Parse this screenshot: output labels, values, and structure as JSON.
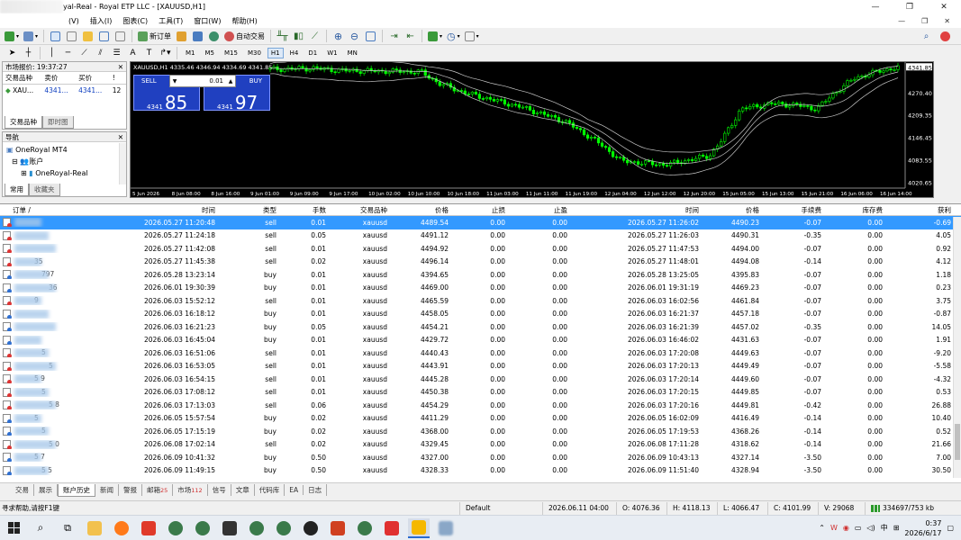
{
  "window": {
    "title": "yal-Real - Royal ETP LLC - [XAUUSD,H1]",
    "controls": [
      "—",
      "❐",
      "✕"
    ]
  },
  "menu": {
    "items": [
      "(V)",
      "插入(I)",
      "图表(C)",
      "工具(T)",
      "窗口(W)",
      "帮助(H)"
    ],
    "mdi_controls": [
      "—",
      "❐",
      "✕"
    ]
  },
  "toolbar": {
    "new_order": "新订单",
    "auto_trade": "自动交易"
  },
  "timeframes": [
    "M1",
    "M5",
    "M15",
    "M30",
    "H1",
    "H4",
    "D1",
    "W1",
    "MN"
  ],
  "timeframe_active": "H1",
  "market_watch": {
    "title": "市场报价: 19:37:27",
    "headers": [
      "交易品种",
      "卖价",
      "买价",
      "!"
    ],
    "rows": [
      {
        "symbol": "XAU...",
        "bid": "4341...",
        "ask": "4341...",
        "spread": "12"
      }
    ],
    "tabs": [
      "交易品种",
      "即时图"
    ]
  },
  "navigator": {
    "title": "导航",
    "items": [
      "OneRoyal MT4",
      "账户",
      "OneRoyal-Real"
    ],
    "tabs": [
      "常用",
      "收藏夹"
    ]
  },
  "chart": {
    "header": "XAUUSD,H1  4335.46 4346.94 4334.69 4341.85",
    "sell_label": "SELL",
    "buy_label": "BUY",
    "lot": "0.01",
    "sell_small": "4341",
    "sell_big": "85",
    "buy_small": "4341",
    "buy_big": "97",
    "current_price": "4341.85",
    "y_ticks": [
      "4341.85",
      "4270.40",
      "4209.35",
      "4146.45",
      "4083.55",
      "4020.65"
    ],
    "x_ticks": [
      "5 Jun 2026",
      "8 Jun 08:00",
      "8 Jun 16:00",
      "9 Jun 01:00",
      "9 Jun 09:00",
      "9 Jun 17:00",
      "10 Jun 02:00",
      "10 Jun 10:00",
      "10 Jun 18:00",
      "11 Jun 03:00",
      "11 Jun 11:00",
      "11 Jun 19:00",
      "12 Jun 04:00",
      "12 Jun 12:00",
      "12 Jun 20:00",
      "15 Jun 05:00",
      "15 Jun 13:00",
      "15 Jun 21:00",
      "16 Jun 06:00",
      "16 Jun 14:00"
    ],
    "colors": {
      "bull": "#00ff00",
      "bear": "#00ff00",
      "bands": "#c8c8c8",
      "background": "#000000"
    }
  },
  "terminal": {
    "headers": [
      "订单 /",
      "时间",
      "类型",
      "手数",
      "交易品种",
      "价格",
      "止损",
      "止盈",
      "时间",
      "价格",
      "手续费",
      "库存费",
      "获利"
    ],
    "rows": [
      {
        "id": "",
        "open_time": "2026.05.27 11:20:48",
        "type": "sell",
        "lots": "0.01",
        "symbol": "xauusd",
        "price": "4489.54",
        "sl": "0.00",
        "tp": "0.00",
        "close_time": "2026.05.27 11:26:02",
        "close_price": "4490.23",
        "commission": "-0.07",
        "swap": "0.00",
        "profit": "-0.69"
      },
      {
        "id": "",
        "open_time": "2026.05.27 11:24:18",
        "type": "sell",
        "lots": "0.05",
        "symbol": "xauusd",
        "price": "4491.12",
        "sl": "0.00",
        "tp": "0.00",
        "close_time": "2026.05.27 11:26:03",
        "close_price": "4490.31",
        "commission": "-0.35",
        "swap": "0.00",
        "profit": "4.05"
      },
      {
        "id": "",
        "open_time": "2026.05.27 11:42:08",
        "type": "sell",
        "lots": "0.01",
        "symbol": "xauusd",
        "price": "4494.92",
        "sl": "0.00",
        "tp": "0.00",
        "close_time": "2026.05.27 11:47:53",
        "close_price": "4494.00",
        "commission": "-0.07",
        "swap": "0.00",
        "profit": "0.92"
      },
      {
        "id": "35",
        "open_time": "2026.05.27 11:45:38",
        "type": "sell",
        "lots": "0.02",
        "symbol": "xauusd",
        "price": "4496.14",
        "sl": "0.00",
        "tp": "0.00",
        "close_time": "2026.05.27 11:48:01",
        "close_price": "4494.08",
        "commission": "-0.14",
        "swap": "0.00",
        "profit": "4.12"
      },
      {
        "id": "797",
        "open_time": "2026.05.28 13:23:14",
        "type": "buy",
        "lots": "0.01",
        "symbol": "xauusd",
        "price": "4394.65",
        "sl": "0.00",
        "tp": "0.00",
        "close_time": "2026.05.28 13:25:05",
        "close_price": "4395.83",
        "commission": "-0.07",
        "swap": "0.00",
        "profit": "1.18"
      },
      {
        "id": "36",
        "open_time": "2026.06.01 19:30:39",
        "type": "buy",
        "lots": "0.01",
        "symbol": "xauusd",
        "price": "4469.00",
        "sl": "0.00",
        "tp": "0.00",
        "close_time": "2026.06.01 19:31:19",
        "close_price": "4469.23",
        "commission": "-0.07",
        "swap": "0.00",
        "profit": "0.23"
      },
      {
        "id": "9",
        "open_time": "2026.06.03 15:52:12",
        "type": "sell",
        "lots": "0.01",
        "symbol": "xauusd",
        "price": "4465.59",
        "sl": "0.00",
        "tp": "0.00",
        "close_time": "2026.06.03 16:02:56",
        "close_price": "4461.84",
        "commission": "-0.07",
        "swap": "0.00",
        "profit": "3.75"
      },
      {
        "id": "",
        "open_time": "2026.06.03 16:18:12",
        "type": "buy",
        "lots": "0.01",
        "symbol": "xauusd",
        "price": "4458.05",
        "sl": "0.00",
        "tp": "0.00",
        "close_time": "2026.06.03 16:21:37",
        "close_price": "4457.18",
        "commission": "-0.07",
        "swap": "0.00",
        "profit": "-0.87"
      },
      {
        "id": "",
        "open_time": "2026.06.03 16:21:23",
        "type": "buy",
        "lots": "0.05",
        "symbol": "xauusd",
        "price": "4454.21",
        "sl": "0.00",
        "tp": "0.00",
        "close_time": "2026.06.03 16:21:39",
        "close_price": "4457.02",
        "commission": "-0.35",
        "swap": "0.00",
        "profit": "14.05"
      },
      {
        "id": "",
        "open_time": "2026.06.03 16:45:04",
        "type": "buy",
        "lots": "0.01",
        "symbol": "xauusd",
        "price": "4429.72",
        "sl": "0.00",
        "tp": "0.00",
        "close_time": "2026.06.03 16:46:02",
        "close_price": "4431.63",
        "commission": "-0.07",
        "swap": "0.00",
        "profit": "1.91"
      },
      {
        "id": "5",
        "open_time": "2026.06.03 16:51:06",
        "type": "sell",
        "lots": "0.01",
        "symbol": "xauusd",
        "price": "4440.43",
        "sl": "0.00",
        "tp": "0.00",
        "close_time": "2026.06.03 17:20:08",
        "close_price": "4449.63",
        "commission": "-0.07",
        "swap": "0.00",
        "profit": "-9.20"
      },
      {
        "id": "5",
        "open_time": "2026.06.03 16:53:05",
        "type": "sell",
        "lots": "0.01",
        "symbol": "xauusd",
        "price": "4443.91",
        "sl": "0.00",
        "tp": "0.00",
        "close_time": "2026.06.03 17:20:13",
        "close_price": "4449.49",
        "commission": "-0.07",
        "swap": "0.00",
        "profit": "-5.58"
      },
      {
        "id": "5 9",
        "open_time": "2026.06.03 16:54:15",
        "type": "sell",
        "lots": "0.01",
        "symbol": "xauusd",
        "price": "4445.28",
        "sl": "0.00",
        "tp": "0.00",
        "close_time": "2026.06.03 17:20:14",
        "close_price": "4449.60",
        "commission": "-0.07",
        "swap": "0.00",
        "profit": "-4.32"
      },
      {
        "id": "5",
        "open_time": "2026.06.03 17:08:12",
        "type": "sell",
        "lots": "0.01",
        "symbol": "xauusd",
        "price": "4450.38",
        "sl": "0.00",
        "tp": "0.00",
        "close_time": "2026.06.03 17:20:15",
        "close_price": "4449.85",
        "commission": "-0.07",
        "swap": "0.00",
        "profit": "0.53"
      },
      {
        "id": "5 8",
        "open_time": "2026.06.03 17:13:03",
        "type": "sell",
        "lots": "0.06",
        "symbol": "xauusd",
        "price": "4454.29",
        "sl": "0.00",
        "tp": "0.00",
        "close_time": "2026.06.03 17:20:16",
        "close_price": "4449.81",
        "commission": "-0.42",
        "swap": "0.00",
        "profit": "26.88"
      },
      {
        "id": "5",
        "open_time": "2026.06.05 15:57:54",
        "type": "buy",
        "lots": "0.02",
        "symbol": "xauusd",
        "price": "4411.29",
        "sl": "0.00",
        "tp": "0.00",
        "close_time": "2026.06.05 16:02:09",
        "close_price": "4416.49",
        "commission": "-0.14",
        "swap": "0.00",
        "profit": "10.40"
      },
      {
        "id": "5",
        "open_time": "2026.06.05 17:15:19",
        "type": "buy",
        "lots": "0.02",
        "symbol": "xauusd",
        "price": "4368.00",
        "sl": "0.00",
        "tp": "0.00",
        "close_time": "2026.06.05 17:19:53",
        "close_price": "4368.26",
        "commission": "-0.14",
        "swap": "0.00",
        "profit": "0.52"
      },
      {
        "id": "5 0",
        "open_time": "2026.06.08 17:02:14",
        "type": "sell",
        "lots": "0.02",
        "symbol": "xauusd",
        "price": "4329.45",
        "sl": "0.00",
        "tp": "0.00",
        "close_time": "2026.06.08 17:11:28",
        "close_price": "4318.62",
        "commission": "-0.14",
        "swap": "0.00",
        "profit": "21.66"
      },
      {
        "id": "5 7",
        "open_time": "2026.06.09 10:41:32",
        "type": "buy",
        "lots": "0.50",
        "symbol": "xauusd",
        "price": "4327.00",
        "sl": "0.00",
        "tp": "0.00",
        "close_time": "2026.06.09 10:43:13",
        "close_price": "4327.14",
        "commission": "-3.50",
        "swap": "0.00",
        "profit": "7.00"
      },
      {
        "id": "5 5",
        "open_time": "2026.06.09 11:49:15",
        "type": "buy",
        "lots": "0.50",
        "symbol": "xauusd",
        "price": "4328.33",
        "sl": "0.00",
        "tp": "0.00",
        "close_time": "2026.06.09 11:51:40",
        "close_price": "4328.94",
        "commission": "-3.50",
        "swap": "0.00",
        "profit": "30.50"
      }
    ],
    "tabs": [
      {
        "label": "交易",
        "count": ""
      },
      {
        "label": "展示",
        "count": ""
      },
      {
        "label": "账户历史",
        "count": ""
      },
      {
        "label": "新闻",
        "count": ""
      },
      {
        "label": "警报",
        "count": ""
      },
      {
        "label": "邮箱",
        "count": "25"
      },
      {
        "label": "市场",
        "count": "112"
      },
      {
        "label": "信号",
        "count": ""
      },
      {
        "label": "文章",
        "count": ""
      },
      {
        "label": "代码库",
        "count": ""
      },
      {
        "label": "EA",
        "count": ""
      },
      {
        "label": "日志",
        "count": ""
      }
    ]
  },
  "status": {
    "help": "寻求帮助,请按F1键",
    "profile": "Default",
    "time": "2026.06.11 04:00",
    "open": "O: 4076.36",
    "high": "H: 4118.13",
    "low": "L: 4066.47",
    "close": "C: 4101.99",
    "volume": "V: 29068",
    "traffic": "334697/753 kb"
  },
  "taskbar": {
    "ime": "中",
    "time": "0:37",
    "date": "2026/6/17"
  }
}
